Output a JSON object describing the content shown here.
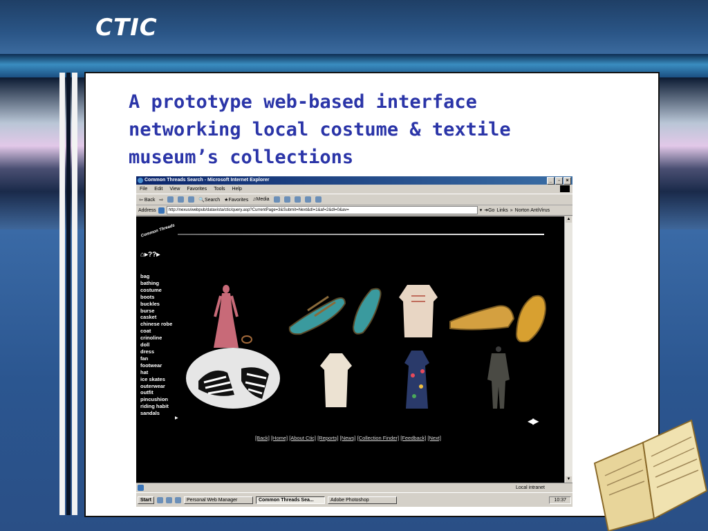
{
  "slide": {
    "title": "CTIC",
    "heading_lines": [
      "A prototype web-based interface",
      "networking local costume & textile",
      "museum’s collections"
    ]
  },
  "browser": {
    "window_title": "Common Threads Search - Microsoft Internet Explorer",
    "window_buttons": [
      "_",
      "▫",
      "×"
    ],
    "menu": [
      "File",
      "Edit",
      "View",
      "Favorites",
      "Tools",
      "Help"
    ],
    "toolbar": {
      "back": "Back",
      "search": "Search",
      "favorites": "Favorites",
      "media": "Media"
    },
    "address_label": "Address",
    "address_value": "http://nexus/webpub/datavista/ctic/query.asp?CurrentPage=3&Submit=Next&dl=1&af=2&dl=0&av=",
    "go_label": "Go",
    "links_label": "Links",
    "norton_label": "Norton AntiVirus",
    "status_zone": "Local intranet"
  },
  "page": {
    "logo_text": "Common Threads",
    "nav_icons": "⌂▸??▸",
    "categories": [
      "bag",
      "bathing",
      "costume",
      "boots",
      "buckles",
      "burse",
      "casket",
      "chinese robe",
      "coat",
      "crinoline",
      "doll",
      "dress",
      "fan",
      "footwear",
      "hat",
      "ice skates",
      "outerwear",
      "outfit",
      "pincushion",
      "riding habit",
      "sandals"
    ],
    "play_icon": "▶",
    "pager": "◀▶",
    "footer_links": [
      "[Back]",
      "[Home]",
      "[About Ctic]",
      "[Reports]",
      "[News]",
      "[Collection Finder]",
      "[Feedback]",
      "[Next]"
    ]
  },
  "taskbar": {
    "start": "Start",
    "tasks": [
      "Personal Web Manager",
      "Common Threads Sea...",
      "Adobe Photoshop"
    ],
    "active_task_index": 1,
    "clock": "10:37"
  }
}
